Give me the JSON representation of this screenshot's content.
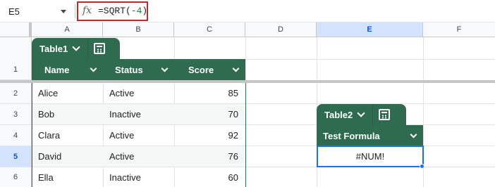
{
  "formula_bar": {
    "name_box": "E5",
    "fx": "fx",
    "formula_prefix": "=SQRT(",
    "formula_arg": "-4",
    "formula_suffix": ")",
    "highlight_color": "#c0292b"
  },
  "columns": [
    "A",
    "B",
    "C",
    "D",
    "E",
    "F"
  ],
  "active_column": "E",
  "rows": [
    "1",
    "2",
    "3",
    "4",
    "5",
    "6"
  ],
  "active_row": "5",
  "table1": {
    "name": "Table1",
    "headers": [
      "Name",
      "Status",
      "Score"
    ],
    "rows": [
      [
        "Alice",
        "Active",
        "85"
      ],
      [
        "Bob",
        "Inactive",
        "70"
      ],
      [
        "Clara",
        "Active",
        "92"
      ],
      [
        "David",
        "Active",
        "76"
      ],
      [
        "Ella",
        "Inactive",
        "60"
      ]
    ],
    "header_color": "#2f6b4f"
  },
  "table2": {
    "name": "Table2",
    "headers": [
      "Test Formula"
    ],
    "rows": [
      [
        "#NUM!"
      ]
    ],
    "header_color": "#2f6b4f"
  },
  "selection_color": "#1a73e8"
}
